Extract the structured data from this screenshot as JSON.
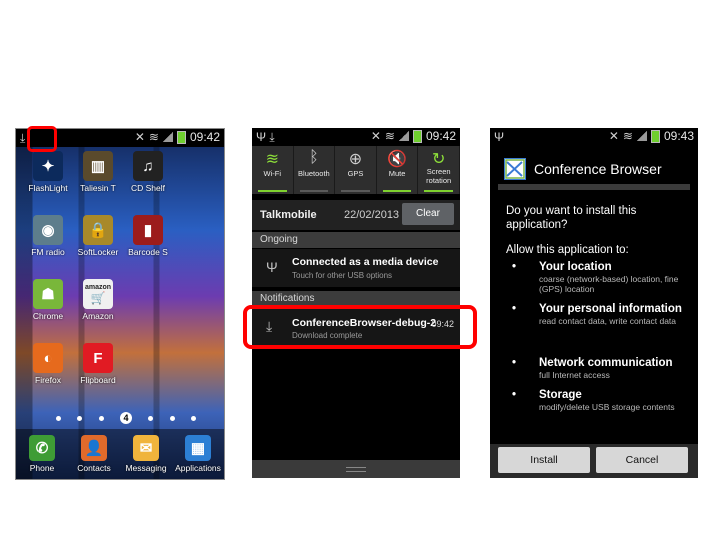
{
  "screen1": {
    "status_time": "09:42",
    "apps": [
      {
        "label": "FlashLight",
        "icon": "flashlight-icon",
        "color": "#0c2a5c",
        "glyph": "✦"
      },
      {
        "label": "Taliesin T",
        "icon": "taliesin-icon",
        "color": "#5a4a2c",
        "glyph": "▥"
      },
      {
        "label": "CD Shelf",
        "icon": "music-note-icon",
        "color": "#222222",
        "glyph": "♫"
      },
      {
        "label": "FM radio",
        "icon": "radio-icon",
        "color": "#5d7d8c",
        "glyph": "◉"
      },
      {
        "label": "SoftLocker",
        "icon": "padlock-icon",
        "color": "#a8892a",
        "glyph": "🔒"
      },
      {
        "label": "Barcode S",
        "icon": "barcode-icon",
        "color": "#9c1c1c",
        "glyph": "▮"
      },
      {
        "label": "Chrome",
        "icon": "android-icon",
        "color": "#79b73a",
        "glyph": "☗"
      },
      {
        "label": "Amazon",
        "icon": "amazon-cart-icon",
        "color": "#f0f0f0",
        "glyph": "🛒"
      },
      {
        "label": "Firefox",
        "icon": "firefox-icon",
        "color": "#e66a1d",
        "glyph": "◐"
      },
      {
        "label": "Flipboard",
        "icon": "flipboard-icon",
        "color": "#e11b23",
        "glyph": "F"
      }
    ],
    "amazon_text": "amazon",
    "page_indicator": "4",
    "dock": [
      {
        "label": "Phone",
        "icon": "phone-icon",
        "color": "#3e9c35",
        "glyph": "✆"
      },
      {
        "label": "Contacts",
        "icon": "contacts-icon",
        "color": "#e06a2b",
        "glyph": "👤"
      },
      {
        "label": "Messaging",
        "icon": "envelope-icon",
        "color": "#f0b43c",
        "glyph": "✉"
      },
      {
        "label": "Applications",
        "icon": "apps-grid-icon",
        "color": "#2c7fd4",
        "glyph": "▦"
      }
    ]
  },
  "screen2": {
    "status_time": "09:42",
    "toggles": [
      {
        "label": "Wi-Fi",
        "icon": "wifi-icon",
        "on": true,
        "glyph": "≋"
      },
      {
        "label": "Bluetooth",
        "icon": "bluetooth-icon",
        "on": false,
        "glyph": "ᛒ"
      },
      {
        "label": "GPS",
        "icon": "gps-icon",
        "on": false,
        "glyph": "⊕"
      },
      {
        "label": "Mute",
        "icon": "mute-icon",
        "on": true,
        "glyph": "🔇"
      },
      {
        "label": "Screen rotation",
        "icon": "rotation-icon",
        "on": true,
        "glyph": "↻"
      }
    ],
    "carrier": "Talkmobile",
    "date": "22/02/2013",
    "clear_label": "Clear",
    "ongoing_header": "Ongoing",
    "ongoing_title": "Connected as a media device",
    "ongoing_sub": "Touch for other USB options",
    "notifications_header": "Notifications",
    "download_title": "ConferenceBrowser-debug-2",
    "download_sub": "Download complete",
    "download_time": "09:42"
  },
  "screen3": {
    "status_time": "09:43",
    "app_name": "Conference Browser",
    "question": "Do you want to install this application?",
    "allow_text": "Allow this application to:",
    "permissions": [
      {
        "title": "Your location",
        "desc": "coarse (network-based) location, fine (GPS) location"
      },
      {
        "title": "Your personal information",
        "desc": "read contact data, write contact data"
      },
      {
        "title": "Network communication",
        "desc": "full Internet access"
      },
      {
        "title": "Storage",
        "desc": "modify/delete USB storage contents"
      }
    ],
    "install_label": "Install",
    "cancel_label": "Cancel"
  },
  "colors": {
    "highlight": "#ff0000",
    "toggle_on": "#7fd12f"
  }
}
